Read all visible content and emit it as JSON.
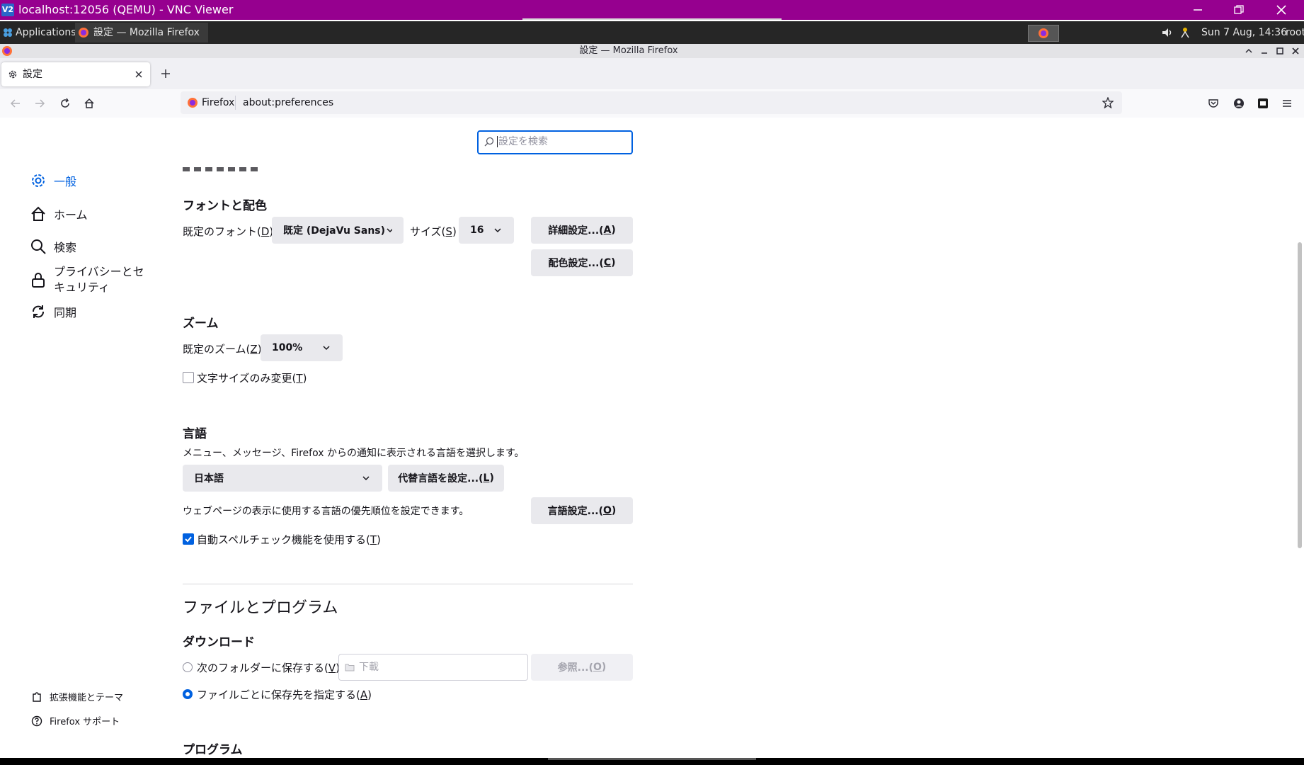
{
  "vnc": {
    "title": "localhost:12056 (QEMU) - VNC Viewer",
    "logo": "V2"
  },
  "panel": {
    "applications": "Applications",
    "task": "設定 — Mozilla Firefox",
    "clock": "Sun  7 Aug, 14:36",
    "user": "root"
  },
  "firefox": {
    "window_title": "設定 — Mozilla Firefox",
    "tab_title": "設定",
    "identity": "Firefox",
    "url": "about:preferences"
  },
  "search": {
    "placeholder": "設定を検索"
  },
  "sidebar": {
    "items": [
      {
        "label": "一般",
        "icon": "gear-icon",
        "selected": true
      },
      {
        "label": "ホーム",
        "icon": "home-icon"
      },
      {
        "label": "検索",
        "icon": "search-icon"
      },
      {
        "label": "プライバシーとセキュリティ",
        "line1": "プライバシーとセ",
        "line2": "キュリティ",
        "icon": "lock-icon"
      },
      {
        "label": "同期",
        "icon": "sync-icon"
      }
    ],
    "footer": [
      {
        "label": "拡張機能とテーマ",
        "icon": "puzzle-icon"
      },
      {
        "label": "Firefox サポート",
        "icon": "help-icon"
      }
    ]
  },
  "fonts": {
    "heading": "フォントと配色",
    "default_font_label": "既定のフォント(",
    "default_font_key": "D",
    "default_font_value": "既定 (DejaVu Sans)",
    "size_label": "サイズ(",
    "size_key": "S",
    "size_value": "16",
    "advanced_button": "詳細設定...(",
    "advanced_key": "A",
    "colors_button": "配色設定...(",
    "colors_key": "C"
  },
  "zoom": {
    "heading": "ズーム",
    "default_zoom_label": "既定のズーム(",
    "default_zoom_key": "Z",
    "default_zoom_value": "100%",
    "text_only_label": "文字サイズのみ変更(",
    "text_only_key": "T",
    "text_only_checked": false
  },
  "language": {
    "heading": "言語",
    "description": "メニュー、メッセージ、Firefox からの通知に表示される言語を選択します。",
    "ui_language": "日本語",
    "alternative_button": "代替言語を設定...(",
    "alternative_key": "L",
    "webpage_description": "ウェブページの表示に使用する言語の優先順位を設定できます。",
    "choose_button": "言語設定...(",
    "choose_key": "O",
    "spellcheck_label": "自動スペルチェック機能を使用する(",
    "spellcheck_key": "T",
    "spellcheck_checked": true
  },
  "files": {
    "heading": "ファイルとプログラム",
    "downloads_heading": "ダウンロード",
    "save_to_label": "次のフォルダーに保存する(",
    "save_to_key": "V",
    "folder_value": "下載",
    "browse_button": "参照...(",
    "browse_key": "O",
    "always_ask_label": "ファイルごとに保存先を指定する(",
    "always_ask_key": "A",
    "selected_option": "always_ask",
    "programs_heading": "プログラム"
  },
  "colors": {
    "accent": "#0061e0",
    "vnc_bar": "#96008f",
    "panel": "#262626"
  }
}
